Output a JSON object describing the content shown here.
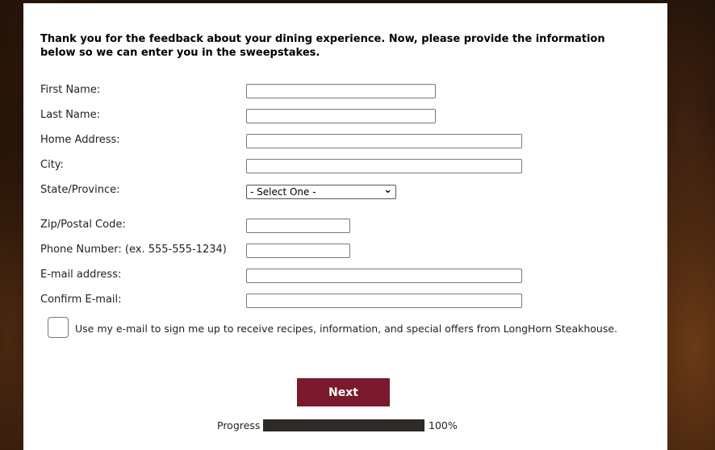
{
  "intro": "Thank you for the feedback about your dining experience. Now, please provide the information below so we can enter you in the sweepstakes.",
  "fields": {
    "first_name": {
      "label": "First Name:",
      "value": ""
    },
    "last_name": {
      "label": "Last Name:",
      "value": ""
    },
    "home_address": {
      "label": "Home Address:",
      "value": ""
    },
    "city": {
      "label": "City:",
      "value": ""
    },
    "state": {
      "label": "State/Province:",
      "selected": "- Select One -"
    },
    "zip": {
      "label": "Zip/Postal Code:",
      "value": ""
    },
    "phone": {
      "label": "Phone Number: (ex. 555-555-1234)",
      "value": ""
    },
    "email": {
      "label": "E-mail address:",
      "value": ""
    },
    "confirm_email": {
      "label": "Confirm E-mail:",
      "value": ""
    }
  },
  "optin": {
    "label": "Use my e-mail to sign me up to receive recipes, information, and special offers from LongHorn Steakhouse.",
    "checked": false
  },
  "next_label": "Next",
  "progress": {
    "label": "Progress",
    "value_text": "100%",
    "fraction": 1.0
  },
  "colors": {
    "button": "#7a1a2c",
    "progress_fill": "#2e2a25"
  }
}
